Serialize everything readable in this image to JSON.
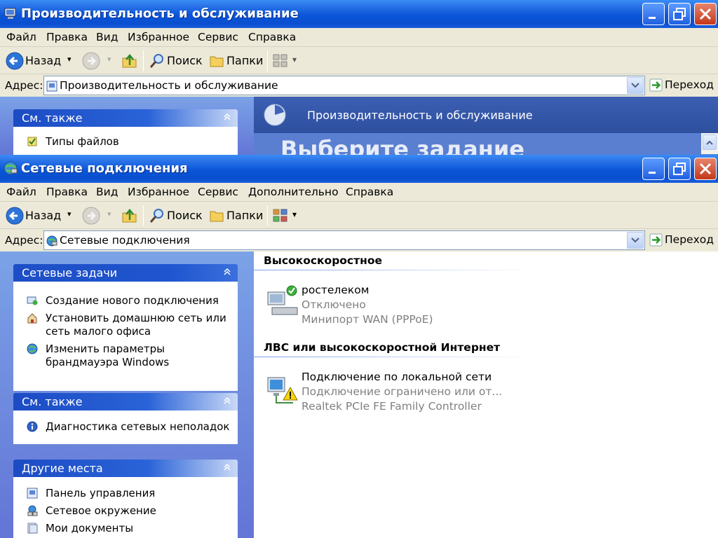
{
  "window_back": {
    "title": "Производительность и обслуживание",
    "menu": [
      "Файл",
      "Правка",
      "Вид",
      "Избранное",
      "Сервис",
      "Справка"
    ],
    "toolbar": {
      "back": "Назад",
      "search": "Поиск",
      "folders": "Папки"
    },
    "address": {
      "label": "Адрес:",
      "value": "Производительность и обслуживание",
      "go": "Переход"
    },
    "sidebar": {
      "see_also_header": "См. также",
      "see_also_items": [
        "Типы файлов"
      ]
    },
    "banner_title": "Производительность и обслуживание",
    "heading": "Выберите задание"
  },
  "window_front": {
    "title": "Сетевые подключения",
    "menu": [
      "Файл",
      "Правка",
      "Вид",
      "Избранное",
      "Сервис",
      "Дополнительно",
      "Справка"
    ],
    "toolbar": {
      "back": "Назад",
      "search": "Поиск",
      "folders": "Папки"
    },
    "address": {
      "label": "Адрес:",
      "value": "Сетевые подключения",
      "go": "Переход"
    },
    "sidebar": {
      "network_tasks": {
        "header": "Сетевые задачи",
        "items": [
          [
            "Создание нового подключения"
          ],
          [
            "Установить домашнюю сеть или",
            "сеть малого офиса"
          ],
          [
            "Изменить параметры",
            "брандмауэра Windows"
          ]
        ]
      },
      "see_also": {
        "header": "См. также",
        "items": [
          "Диагностика сетевых неполадок"
        ]
      },
      "other_places": {
        "header": "Другие места",
        "items": [
          "Панель управления",
          "Сетевое окружение",
          "Мои документы"
        ]
      }
    },
    "groups": [
      {
        "title": "Высокоскоростное",
        "connections": [
          {
            "name": "ростелеком",
            "status": "Отключено",
            "device": "Минипорт WAN (PPPoE)"
          }
        ]
      },
      {
        "title": "ЛВС или высокоскоростной Интернет",
        "connections": [
          {
            "name": "Подключение по локальной сети",
            "status": "Подключение ограничено или от...",
            "device": "Realtek PCIe FE Family Controller"
          }
        ]
      }
    ]
  }
}
